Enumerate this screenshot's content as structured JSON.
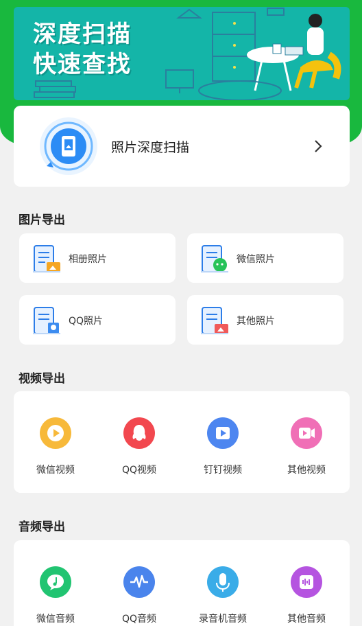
{
  "banner": {
    "line1": "深度扫描",
    "line2": "快速查找"
  },
  "scan": {
    "label": "照片深度扫描"
  },
  "photo_section": {
    "title": "图片导出",
    "items": [
      {
        "label": "相册照片",
        "icon": "album-photo-icon"
      },
      {
        "label": "微信照片",
        "icon": "wechat-photo-icon"
      },
      {
        "label": "QQ照片",
        "icon": "qq-photo-icon"
      },
      {
        "label": "其他照片",
        "icon": "other-photo-icon"
      }
    ]
  },
  "video_section": {
    "title": "视频导出",
    "items": [
      {
        "label": "微信视频",
        "icon": "wechat-video-icon",
        "color": "#f7b93a"
      },
      {
        "label": "QQ视频",
        "icon": "qq-video-icon",
        "color": "#f2484f"
      },
      {
        "label": "钉钉视频",
        "icon": "dingtalk-video-icon",
        "color": "#4d86f0"
      },
      {
        "label": "其他视频",
        "icon": "other-video-icon",
        "color": "#f06fb6"
      }
    ]
  },
  "audio_section": {
    "title": "音频导出",
    "items": [
      {
        "label": "微信音频",
        "icon": "wechat-audio-icon",
        "color": "#21c471"
      },
      {
        "label": "QQ音频",
        "icon": "qq-audio-icon",
        "color": "#4a84ec"
      },
      {
        "label": "录音机音频",
        "icon": "recorder-audio-icon",
        "color": "#3aace8"
      },
      {
        "label": "其他音频",
        "icon": "other-audio-icon",
        "color": "#b554e0"
      }
    ]
  },
  "colors": {
    "brand_green": "#19b83e",
    "banner_teal": "#14b5a8",
    "page_bg": "#f1f1f1"
  }
}
